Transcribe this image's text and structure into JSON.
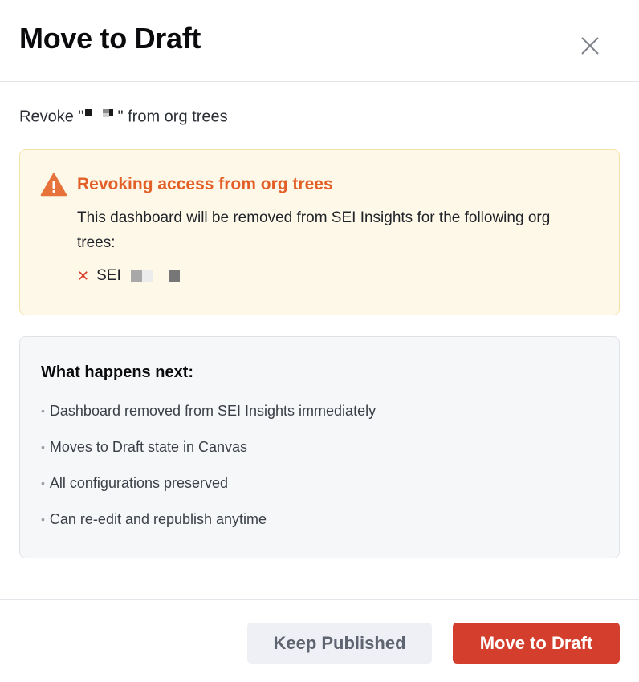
{
  "dialog": {
    "title": "Move to Draft",
    "subtitle_prefix": "Revoke \"",
    "subtitle_suffix": "\" from org trees"
  },
  "warning": {
    "title": "Revoking access from org trees",
    "body": "This dashboard will be removed from SEI Insights for the following org trees:",
    "org_trees": [
      {
        "name": "SEI"
      }
    ],
    "icon": "warning-triangle-icon",
    "accent_color": "#e35f28"
  },
  "next_steps": {
    "title": "What happens next:",
    "items": [
      "Dashboard removed from SEI Insights immediately",
      "Moves to Draft state in Canvas",
      "All configurations preserved",
      "Can re-edit and republish anytime"
    ]
  },
  "footer": {
    "secondary_label": "Keep Published",
    "primary_label": "Move to Draft",
    "primary_color": "#d43f2d"
  }
}
